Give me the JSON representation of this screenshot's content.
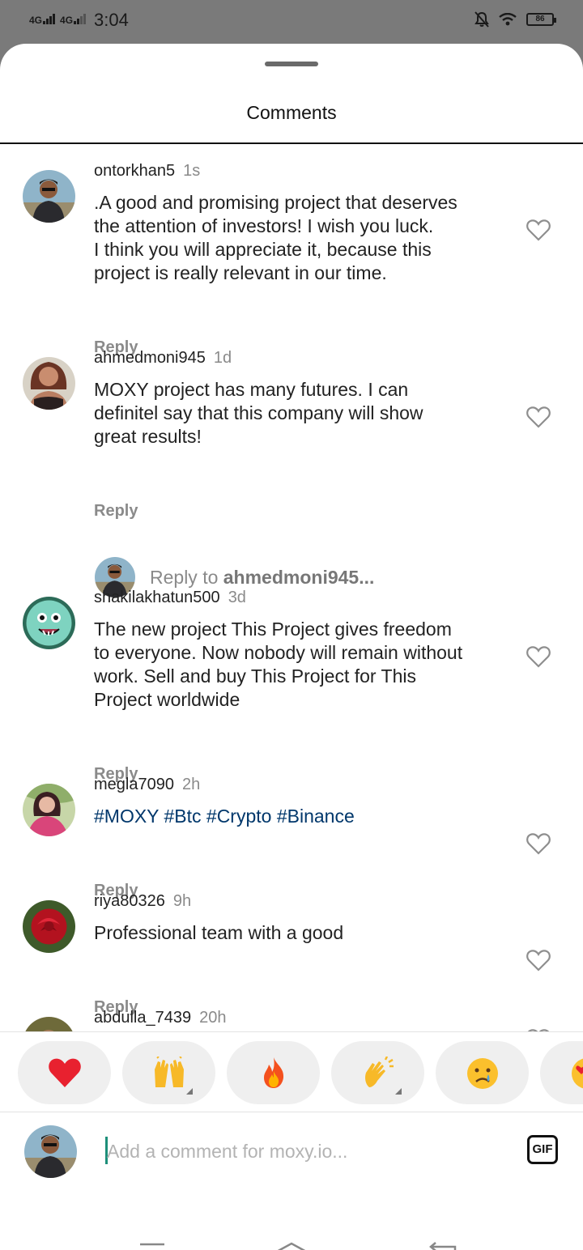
{
  "status_bar": {
    "network_1": "4G",
    "network_2": "4G",
    "time": "3:04",
    "battery": "86",
    "icons": [
      "signal-icon",
      "silent-bell-icon",
      "wifi-icon",
      "battery-icon"
    ]
  },
  "sheet": {
    "title": "Comments"
  },
  "comments": [
    {
      "username": "ontorkhan5",
      "time": "1s",
      "text_lines": [
        ".A good and promising project that deserves",
        "the attention of investors! I wish you luck.",
        "I think you will appreciate it, because this",
        "project is really relevant in our time."
      ],
      "reply_label": "Reply"
    },
    {
      "username": "ahmedmoni945",
      "time": "1d",
      "text_lines": [
        "MOXY project has many futures. I can",
        "definitel say that this company will show",
        "great results!"
      ],
      "reply_label": "Reply"
    },
    {
      "username": "shakilakhatun500",
      "time": "3d",
      "text_lines": [
        "The new project This Project gives freedom",
        "to everyone. Now nobody will remain without",
        "work. Sell and buy This Project for This",
        "Project worldwide"
      ],
      "reply_label": "Reply"
    },
    {
      "username": "megla7090",
      "time": "2h",
      "text_lines": [
        "#MOXY #Btc #Crypto #Binance"
      ],
      "reply_label": "Reply"
    },
    {
      "username": "riya80326",
      "time": "9h",
      "text_lines": [
        "Professional team with a good"
      ],
      "reply_label": "Reply"
    },
    {
      "username": "abdulla_7439",
      "time": "20h"
    }
  ],
  "reply_prompt": {
    "prefix": "Reply to ",
    "target": "ahmedmoni945..."
  },
  "emoji_reactions": [
    "red-heart",
    "raising-hands",
    "fire",
    "clapping-hands",
    "crying-face",
    "heart-eyes-face"
  ],
  "comment_input": {
    "placeholder": "Add a comment for moxy.io...",
    "gif_label": "GIF"
  },
  "colors": {
    "hashtag": "#00376b",
    "muted": "#8a8a8a",
    "cursor": "#1d8f7a"
  }
}
